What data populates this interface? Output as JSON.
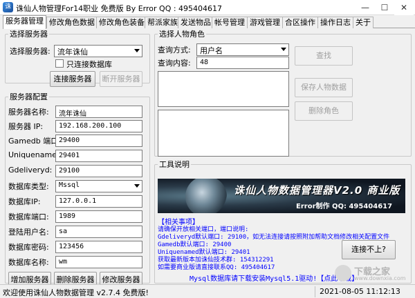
{
  "window": {
    "title": "诛仙人物管理For14职业 免费版 By Error QQ : 495404617",
    "minimize": "—",
    "maximize": "☐",
    "close": "✕"
  },
  "tabs": [
    "服务器管理",
    "修改角色数据",
    "修改角色装备",
    "帮派家族",
    "发送物品",
    "帐号管理",
    "游戏管理",
    "合区操作",
    "操作日志",
    "关于"
  ],
  "select_server": {
    "legend": "选择服务器",
    "label": "选择服务器:",
    "value": "流年诛仙",
    "checkbox_label": "只连接数据库",
    "connect_button": "连接服务器",
    "disconnect_button": "断开服务器"
  },
  "server_config": {
    "legend": "服务器配置",
    "fields": [
      {
        "label": "服务器名称:",
        "value": "流年诛仙"
      },
      {
        "label": "服务器 IP:",
        "value": "192.168.200.100"
      },
      {
        "label": "Gamedb 端口:",
        "value": "29400"
      },
      {
        "label": "Uniquenamed:",
        "value": "29401"
      },
      {
        "label": "Gdeliveryd:",
        "value": "29100"
      },
      {
        "label": "数据库类型:",
        "value": "Mssql"
      },
      {
        "label": "数据库IP:",
        "value": "127.0.0.1"
      },
      {
        "label": "数据库端口:",
        "value": "1989"
      },
      {
        "label": "登陆用户名:",
        "value": "sa"
      },
      {
        "label": "数据库密码:",
        "value": "123456"
      },
      {
        "label": "数据库名称:",
        "value": "wm"
      }
    ],
    "add_button": "增加服务器",
    "delete_button": "删除服务器",
    "modify_button": "修改服务器"
  },
  "select_role": {
    "legend": "选择人物角色",
    "query_method_label": "查询方式:",
    "query_method_value": "用户名",
    "query_content_label": "查询内容:",
    "query_content_value": "48",
    "find_button": "查找",
    "save_button": "保存人物数据",
    "delete_button": "删除角色"
  },
  "tool_info": {
    "legend": "工具说明",
    "banner_title": "诛仙人物数据管理器V2.0 商业版",
    "banner_sub": "Error制作 QQ: 495404617",
    "notes_title": "【相关事项】",
    "notes": [
      "请确保开放相关端口，端口说明:",
      "Gdeliveryd默认端口: 29100，如无法连接请按照附加帮助文档修改相关配置文件",
      "Gamedb默认端口: 29400",
      "Uniquenamed默认端口: 29401",
      "获取最新版本加诛仙技术群: 154312291",
      "如需要商业版请直接联系QQ: 495404617"
    ],
    "cant_connect_button": "连接不上?",
    "mysql_note": "Mysql数据库请下载安装Mysql5.1驱动!【点此下载】"
  },
  "status": {
    "left": "欢迎使用诛仙人物数据管理 v2.7.4 免费版!",
    "right": "2021-08-05 11:12:13"
  },
  "watermark": {
    "line1": "下载之家",
    "line2": "www.downxia.com"
  }
}
